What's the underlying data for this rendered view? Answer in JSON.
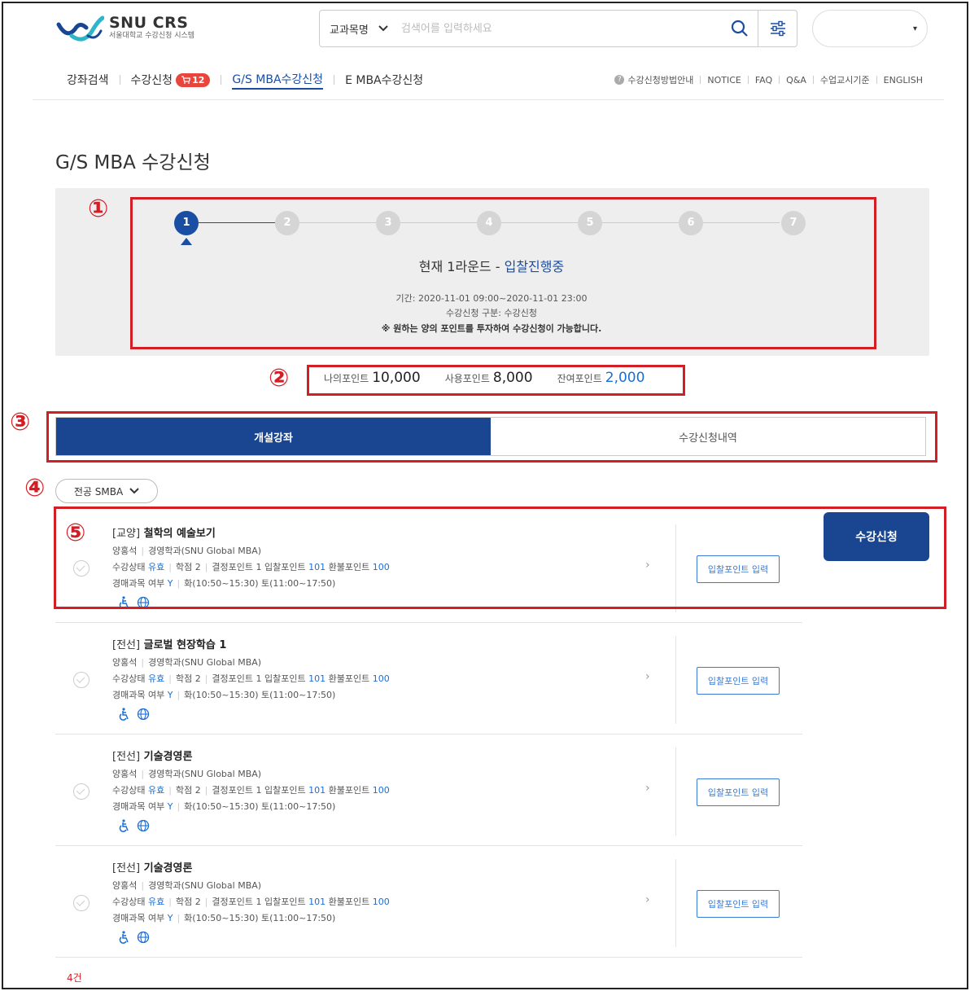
{
  "header": {
    "logo_title": "SNU CRS",
    "logo_subtitle": "서울대학교 수강신청 시스템",
    "search_scope": "교과목명",
    "search_placeholder": "검색어를 입력하세요",
    "user_select": "▾"
  },
  "nav": {
    "items": [
      {
        "label": "강좌검색"
      },
      {
        "label": "수강신청",
        "badge": "12"
      },
      {
        "label": "G/S MBA수강신청",
        "active": true
      },
      {
        "label": "E MBA수강신청"
      }
    ],
    "util": [
      "수강신청방법안내",
      "NOTICE",
      "FAQ",
      "Q&A",
      "수업교시기준",
      "ENGLISH"
    ]
  },
  "page_title": "G/S MBA 수강신청",
  "annotations": [
    "①",
    "②",
    "③",
    "④",
    "⑤"
  ],
  "round": {
    "steps": [
      "1",
      "2",
      "3",
      "4",
      "5",
      "6",
      "7"
    ],
    "current_step": 1,
    "title": "현재 1라운드 - ",
    "status": "입찰진행중",
    "period": "기간: 2020-11-01 09:00~2020-11-01 23:00",
    "type": "수강신청 구분: 수강신청",
    "notice": "※ 원하는 양의 포인트를 투자하여 수강신청이 가능합니다."
  },
  "points": {
    "my_label": "나의포인트",
    "my_value": "10,000",
    "used_label": "사용포인트",
    "used_value": "8,000",
    "remain_label": "잔여포인트",
    "remain_value": "2,000"
  },
  "tabs": {
    "open": "개설강좌",
    "history": "수강신청내역"
  },
  "filter": {
    "major": "전공 SMBA"
  },
  "courses": [
    {
      "cat": "[교양]",
      "name": "철학의 예술보기",
      "prof": "양홍석",
      "dept": "경영학과(SNU Global MBA)",
      "status_label": "수강상태",
      "status": "유효",
      "credit": "학점 2",
      "fail": "결정포인트 1",
      "bid_label": "입찰포인트",
      "bid": "101",
      "refund_label": "환불포인트",
      "refund": "100",
      "prereq_label": "경매과목 여부",
      "prereq": "Y",
      "time": "화(10:50~15:30) 토(11:00~17:50)",
      "bid_button": "입찰포인트 입력"
    },
    {
      "cat": "[전선]",
      "name": "글로벌 현장학습 1",
      "prof": "양홍석",
      "dept": "경영학과(SNU Global MBA)",
      "status_label": "수강상태",
      "status": "유효",
      "credit": "학점 2",
      "fail": "결정포인트 1",
      "bid_label": "입찰포인트",
      "bid": "101",
      "refund_label": "환불포인트",
      "refund": "100",
      "prereq_label": "경매과목 여부",
      "prereq": "Y",
      "time": "화(10:50~15:30) 토(11:00~17:50)",
      "bid_button": "입찰포인트 입력"
    },
    {
      "cat": "[전선]",
      "name": "기술경영론",
      "prof": "양홍석",
      "dept": "경영학과(SNU Global MBA)",
      "status_label": "수강상태",
      "status": "유효",
      "credit": "학점 2",
      "fail": "결정포인트 1",
      "bid_label": "입찰포인트",
      "bid": "101",
      "refund_label": "환불포인트",
      "refund": "100",
      "prereq_label": "경매과목 여부",
      "prereq": "Y",
      "time": "화(10:50~15:30) 토(11:00~17:50)",
      "bid_button": "입찰포인트 입력"
    },
    {
      "cat": "[전선]",
      "name": "기술경영론",
      "prof": "양홍석",
      "dept": "경영학과(SNU Global MBA)",
      "status_label": "수강상태",
      "status": "유효",
      "credit": "학점 2",
      "fail": "결정포인트 1",
      "bid_label": "입찰포인트",
      "bid": "101",
      "refund_label": "환불포인트",
      "refund": "100",
      "prereq_label": "경매과목 여부",
      "prereq": "Y",
      "time": "화(10:50~15:30) 토(11:00~17:50)",
      "bid_button": "입찰포인트 입력"
    }
  ],
  "enroll_button": "수강신청",
  "total": "4건",
  "colors": {
    "primary": "#1a4591",
    "accent": "#1a6fd6",
    "annotation": "#d21e24",
    "badge": "#e8453c"
  }
}
